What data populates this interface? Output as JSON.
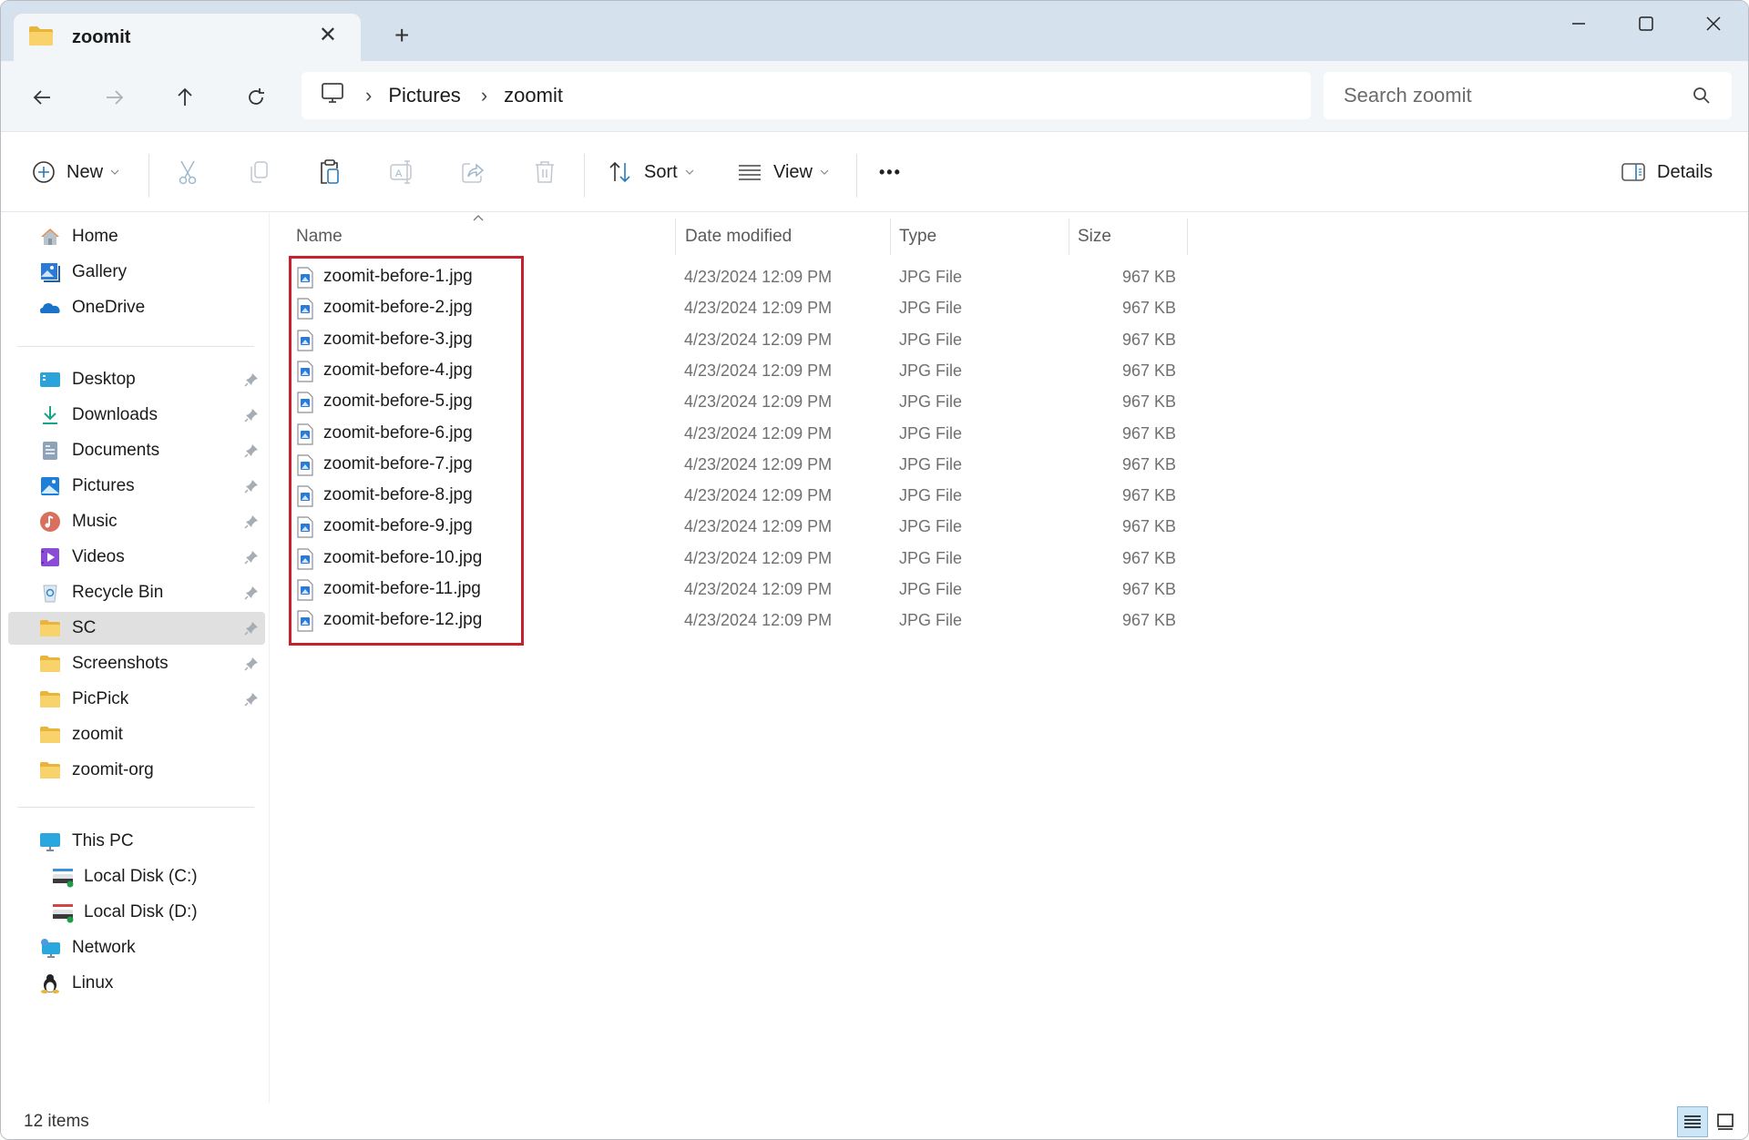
{
  "window": {
    "tab_title": "zoomit",
    "new_tab_symbol": "+",
    "tab_close_symbol": "✕"
  },
  "nav": {
    "breadcrumbs": [
      "Pictures",
      "zoomit"
    ],
    "breadcrumb_separator": "›",
    "search_placeholder": "Search zoomit",
    "search_value": ""
  },
  "toolbar": {
    "new_label": "New",
    "sort_label": "Sort",
    "view_label": "View",
    "more_label": "•••",
    "details_label": "Details"
  },
  "sidebar": {
    "quick": [
      {
        "label": "Home",
        "icon": "home-icon"
      },
      {
        "label": "Gallery",
        "icon": "gallery-icon"
      },
      {
        "label": "OneDrive",
        "icon": "onedrive-icon"
      }
    ],
    "pinned": [
      {
        "label": "Desktop",
        "icon": "desktop-icon",
        "pinned": true
      },
      {
        "label": "Downloads",
        "icon": "downloads-icon",
        "pinned": true
      },
      {
        "label": "Documents",
        "icon": "documents-icon",
        "pinned": true
      },
      {
        "label": "Pictures",
        "icon": "pictures-icon",
        "pinned": true
      },
      {
        "label": "Music",
        "icon": "music-icon",
        "pinned": true
      },
      {
        "label": "Videos",
        "icon": "videos-icon",
        "pinned": true
      },
      {
        "label": "Recycle Bin",
        "icon": "recycle-bin-icon",
        "pinned": true
      },
      {
        "label": "SC",
        "icon": "folder-icon",
        "pinned": true,
        "selected": true
      },
      {
        "label": "Screenshots",
        "icon": "folder-icon",
        "pinned": true
      },
      {
        "label": "PicPick",
        "icon": "folder-icon",
        "pinned": true
      },
      {
        "label": "zoomit",
        "icon": "folder-icon",
        "pinned": false
      },
      {
        "label": "zoomit-org",
        "icon": "folder-icon",
        "pinned": false
      }
    ],
    "devices": [
      {
        "label": "This PC",
        "icon": "this-pc-icon",
        "sub": false
      },
      {
        "label": "Local Disk (C:)",
        "icon": "drive-c-icon",
        "sub": true
      },
      {
        "label": "Local Disk (D:)",
        "icon": "drive-d-icon",
        "sub": true
      },
      {
        "label": "Network",
        "icon": "network-icon",
        "sub": false
      },
      {
        "label": "Linux",
        "icon": "linux-icon",
        "sub": false
      }
    ]
  },
  "table": {
    "columns": [
      "Name",
      "Date modified",
      "Type",
      "Size"
    ],
    "sort_column": "Name",
    "sort_direction": "ascending",
    "rows": [
      {
        "name": "zoomit-before-1.jpg",
        "date": "4/23/2024 12:09 PM",
        "type": "JPG File",
        "size": "967 KB"
      },
      {
        "name": "zoomit-before-2.jpg",
        "date": "4/23/2024 12:09 PM",
        "type": "JPG File",
        "size": "967 KB"
      },
      {
        "name": "zoomit-before-3.jpg",
        "date": "4/23/2024 12:09 PM",
        "type": "JPG File",
        "size": "967 KB"
      },
      {
        "name": "zoomit-before-4.jpg",
        "date": "4/23/2024 12:09 PM",
        "type": "JPG File",
        "size": "967 KB"
      },
      {
        "name": "zoomit-before-5.jpg",
        "date": "4/23/2024 12:09 PM",
        "type": "JPG File",
        "size": "967 KB"
      },
      {
        "name": "zoomit-before-6.jpg",
        "date": "4/23/2024 12:09 PM",
        "type": "JPG File",
        "size": "967 KB"
      },
      {
        "name": "zoomit-before-7.jpg",
        "date": "4/23/2024 12:09 PM",
        "type": "JPG File",
        "size": "967 KB"
      },
      {
        "name": "zoomit-before-8.jpg",
        "date": "4/23/2024 12:09 PM",
        "type": "JPG File",
        "size": "967 KB"
      },
      {
        "name": "zoomit-before-9.jpg",
        "date": "4/23/2024 12:09 PM",
        "type": "JPG File",
        "size": "967 KB"
      },
      {
        "name": "zoomit-before-10.jpg",
        "date": "4/23/2024 12:09 PM",
        "type": "JPG File",
        "size": "967 KB"
      },
      {
        "name": "zoomit-before-11.jpg",
        "date": "4/23/2024 12:09 PM",
        "type": "JPG File",
        "size": "967 KB"
      },
      {
        "name": "zoomit-before-12.jpg",
        "date": "4/23/2024 12:09 PM",
        "type": "JPG File",
        "size": "967 KB"
      }
    ]
  },
  "status": {
    "item_count": "12 items",
    "active_view": "details"
  },
  "colors": {
    "titlebar_bg": "#d5e1ed",
    "highlight_box": "#c8202e",
    "selected_nav_bg": "#e0e0e0",
    "folder_yellow": "#f4c542",
    "accent_blue": "#2b7bd6"
  }
}
